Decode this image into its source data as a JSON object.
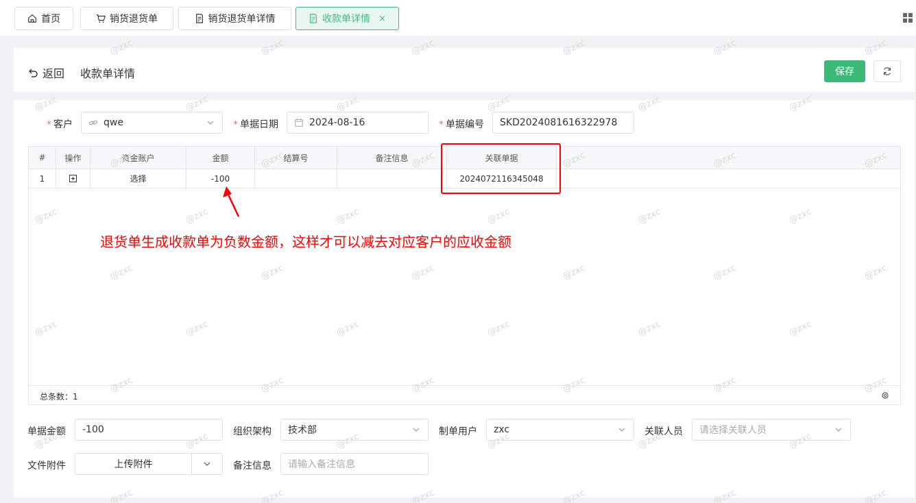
{
  "tabs": [
    {
      "label": "首页",
      "icon": "home-icon"
    },
    {
      "label": "销货退货单",
      "icon": "cart-icon"
    },
    {
      "label": "销货退货单详情",
      "icon": "document-icon"
    },
    {
      "label": "收款单详情",
      "icon": "document-icon",
      "active": true,
      "close": "×"
    }
  ],
  "header": {
    "back_label": "返回",
    "title": "收款单详情",
    "save_label": "保存"
  },
  "form": {
    "customer_label": "客户",
    "customer_value": "qwe",
    "date_label": "单据日期",
    "date_value": "2024-08-16",
    "number_label": "单据编号",
    "number_value": "SKD2024081616322978",
    "required_mark": "*"
  },
  "table": {
    "columns": [
      "#",
      "操作",
      "资金账户",
      "金额",
      "结算号",
      "备注信息",
      "关联单据"
    ],
    "rows": [
      {
        "index": "1",
        "account": "选择",
        "amount": "-100",
        "settle_no": "",
        "note": "",
        "related": "2024072116345048"
      }
    ],
    "footer_count": "总条数：1"
  },
  "annotation": "退货单生成收款单为负数金额，这样才可以减去对应客户的应收金额",
  "bottom": {
    "amount_label": "单据金额",
    "amount_value": "-100",
    "org_label": "组织架构",
    "org_value": "技术部",
    "creator_label": "制单用户",
    "creator_value": "zxc",
    "related_person_label": "关联人员",
    "related_person_placeholder": "请选择关联人员",
    "attachment_label": "文件附件",
    "upload_label": "上传附件",
    "remark_label": "备注信息",
    "remark_placeholder": "请输入备注信息"
  },
  "watermark": "@zxc",
  "colors": {
    "primary": "#3cb878",
    "annotation": "#ff0000"
  }
}
